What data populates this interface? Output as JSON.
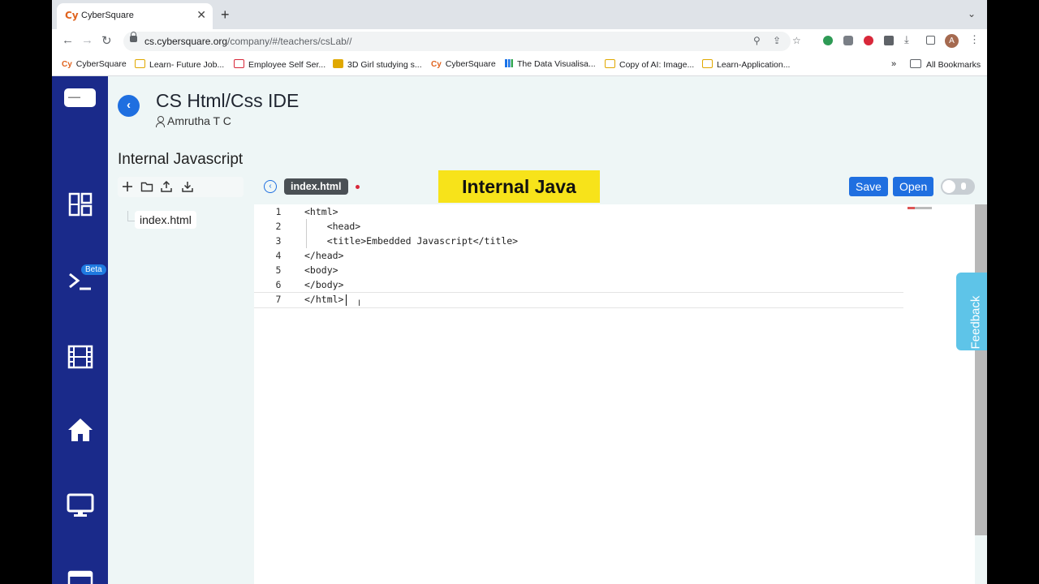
{
  "browser": {
    "tab_title": "CyberSquare",
    "tab_favicon": "Cy",
    "tab_close": "✕",
    "new_tab": "+",
    "url_host": "cs.cybersquare.org",
    "url_path": "/company/#/teachers/csLab//",
    "avatar_letter": "A",
    "bookmarks": [
      {
        "label": "CyberSquare",
        "icon": "cybersquare-icon"
      },
      {
        "label": "Learn- Future Job...",
        "icon": "doc-icon"
      },
      {
        "label": "Employee Self Ser...",
        "icon": "employee-icon"
      },
      {
        "label": "3D Girl studying s...",
        "icon": "image-icon"
      },
      {
        "label": "CyberSquare",
        "icon": "cybersquare-icon"
      },
      {
        "label": "The Data Visualisa...",
        "icon": "chart-icon"
      },
      {
        "label": "Copy of AI: Image...",
        "icon": "doc-icon"
      },
      {
        "label": "Learn-Application...",
        "icon": "doc-icon"
      }
    ],
    "bookmarks_overflow": "»",
    "all_bookmarks": "All Bookmarks"
  },
  "app": {
    "title": "CS Html/Css IDE",
    "user": "Amrutha T C",
    "section": "Internal Javascript",
    "beta_badge": "Beta",
    "files": [
      "index.html"
    ],
    "active_tab": "index.html",
    "banner": "Internal Java",
    "save_label": "Save",
    "open_label": "Open",
    "feedback_label": "Feedback",
    "code_lines": [
      {
        "n": "1",
        "text": "<html>"
      },
      {
        "n": "2",
        "text": "    <head>"
      },
      {
        "n": "3",
        "text": "    <title>Embedded Javascript</title>"
      },
      {
        "n": "4",
        "text": "</head>"
      },
      {
        "n": "5",
        "text": "<body>"
      },
      {
        "n": "6",
        "text": "</body>"
      },
      {
        "n": "7",
        "text": "</html>"
      }
    ]
  },
  "colors": {
    "sidebar": "#1a2a8a",
    "accent": "#1f6fe0",
    "banner": "#f7e31a",
    "feedback": "#5ec4e8"
  }
}
